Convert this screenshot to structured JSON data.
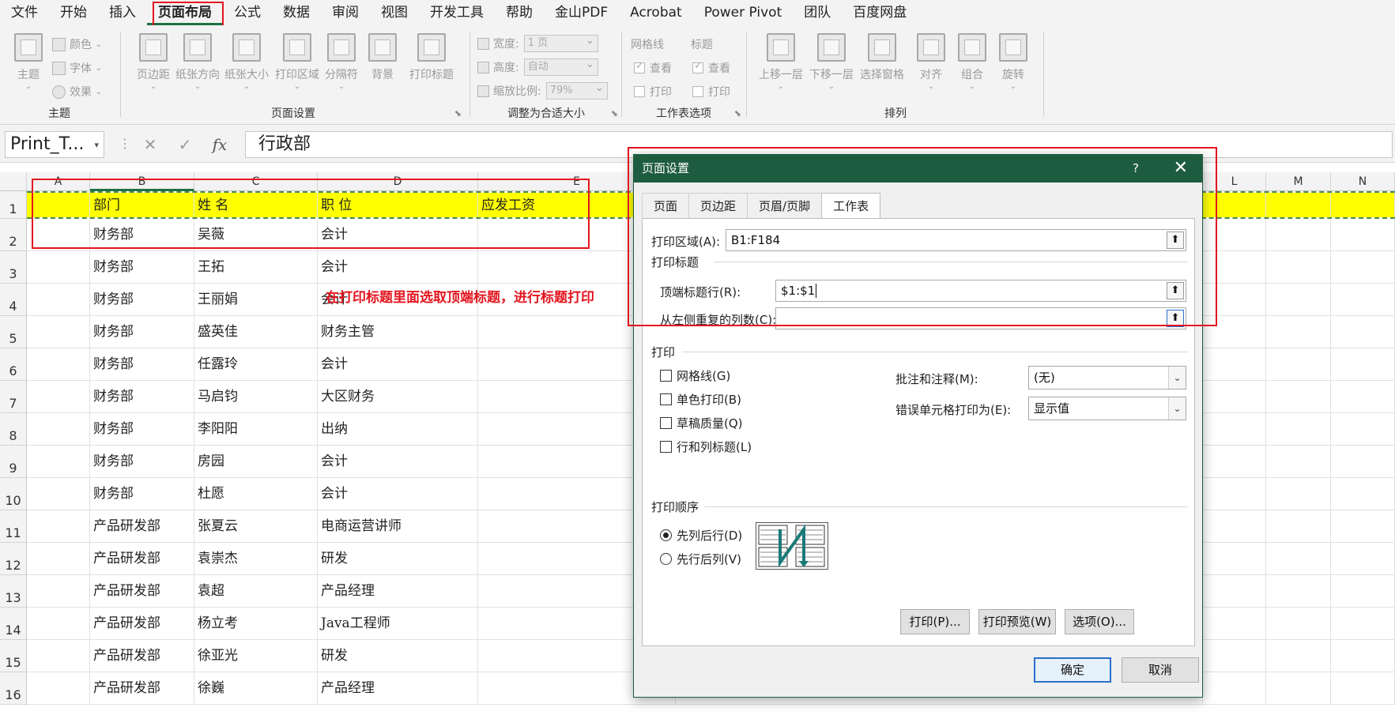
{
  "menu": {
    "items": [
      "文件",
      "开始",
      "插入",
      "页面布局",
      "公式",
      "数据",
      "审阅",
      "视图",
      "开发工具",
      "帮助",
      "金山PDF",
      "Acrobat",
      "Power Pivot",
      "团队",
      "百度网盘"
    ],
    "active_index": 3
  },
  "ribbon": {
    "theme": {
      "label": "主题",
      "btn": "主题",
      "colors": "颜色",
      "fonts": "字体",
      "effects": "效果"
    },
    "page_setup": {
      "label": "页面设置",
      "margins": "页边距",
      "orientation": "纸张方向",
      "size": "纸张大小",
      "print_area": "打印区域",
      "breaks": "分隔符",
      "background": "背景",
      "print_titles": "打印标题"
    },
    "scale": {
      "label": "调整为合适大小",
      "width_label": "宽度:",
      "width_value": "1 页",
      "height_label": "高度:",
      "height_value": "自动",
      "scale_label": "缩放比例:",
      "scale_value": "79%"
    },
    "sheet_options": {
      "label": "工作表选项",
      "gridlines": "网格线",
      "headings": "标题",
      "view": "查看",
      "print": "打印"
    },
    "arrange": {
      "label": "排列",
      "bring_forward": "上移一层",
      "send_backward": "下移一层",
      "selection_pane": "选择窗格",
      "align": "对齐",
      "group": "组合",
      "rotate": "旋转"
    }
  },
  "formula_bar": {
    "name_box": "Print_T...",
    "cancel": "✕",
    "enter": "✓",
    "fx": "fx",
    "value": "行政部"
  },
  "grid": {
    "columns": [
      "A",
      "B",
      "C",
      "D",
      "E",
      "L",
      "M",
      "N"
    ],
    "rows": [
      {
        "num": "1",
        "b": "部门",
        "c": "姓 名",
        "d": "职 位",
        "e": "应发工资"
      },
      {
        "num": "2",
        "b": "财务部",
        "c": "吴薇",
        "d": "会计",
        "e": ""
      },
      {
        "num": "3",
        "b": "财务部",
        "c": "王拓",
        "d": "会计",
        "e": ""
      },
      {
        "num": "4",
        "b": "财务部",
        "c": "王丽娟",
        "d": "会计",
        "e": ""
      },
      {
        "num": "5",
        "b": "财务部",
        "c": "盛英佳",
        "d": "财务主管",
        "e": ""
      },
      {
        "num": "6",
        "b": "财务部",
        "c": "任露玲",
        "d": "会计",
        "e": ""
      },
      {
        "num": "7",
        "b": "财务部",
        "c": "马启钧",
        "d": "大区财务",
        "e": ""
      },
      {
        "num": "8",
        "b": "财务部",
        "c": "李阳阳",
        "d": "出纳",
        "e": ""
      },
      {
        "num": "9",
        "b": "财务部",
        "c": "房园",
        "d": "会计",
        "e": ""
      },
      {
        "num": "10",
        "b": "财务部",
        "c": "杜愿",
        "d": "会计",
        "e": ""
      },
      {
        "num": "11",
        "b": "产品研发部",
        "c": "张夏云",
        "d": "电商运营讲师",
        "e": ""
      },
      {
        "num": "12",
        "b": "产品研发部",
        "c": "袁崇杰",
        "d": "研发",
        "e": ""
      },
      {
        "num": "13",
        "b": "产品研发部",
        "c": "袁超",
        "d": "产品经理",
        "e": ""
      },
      {
        "num": "14",
        "b": "产品研发部",
        "c": "杨立考",
        "d": "Java工程师",
        "e": ""
      },
      {
        "num": "15",
        "b": "产品研发部",
        "c": "徐亚光",
        "d": "研发",
        "e": ""
      },
      {
        "num": "16",
        "b": "产品研发部",
        "c": "徐巍",
        "d": "产品经理",
        "e": ""
      }
    ]
  },
  "annotation": "在打印标题里面选取顶端标题，进行标题打印",
  "dialog": {
    "title": "页面设置",
    "help": "?",
    "close": "✕",
    "tabs": [
      "页面",
      "页边距",
      "页眉/页脚",
      "工作表"
    ],
    "active_tab": 3,
    "print_area_label": "打印区域(A):",
    "print_area_value": "B1:F184",
    "print_titles_label": "打印标题",
    "rows_repeat_label": "顶端标题行(R):",
    "rows_repeat_value": "$1:$1",
    "cols_repeat_label": "从左侧重复的列数(C):",
    "cols_repeat_value": "",
    "print_section_label": "打印",
    "checkboxes": [
      "网格线(G)",
      "单色打印(B)",
      "草稿质量(Q)",
      "行和列标题(L)"
    ],
    "comments_label": "批注和注释(M):",
    "comments_value": "(无)",
    "errors_label": "错误单元格打印为(E):",
    "errors_value": "显示值",
    "order_label": "打印顺序",
    "order_options": [
      "先列后行(D)",
      "先行后列(V)"
    ],
    "order_selected": 0,
    "buttons": {
      "print": "打印(P)...",
      "preview": "打印预览(W)",
      "options": "选项(O)...",
      "ok": "确定",
      "cancel": "取消"
    },
    "collapse_icon": "⬆"
  }
}
